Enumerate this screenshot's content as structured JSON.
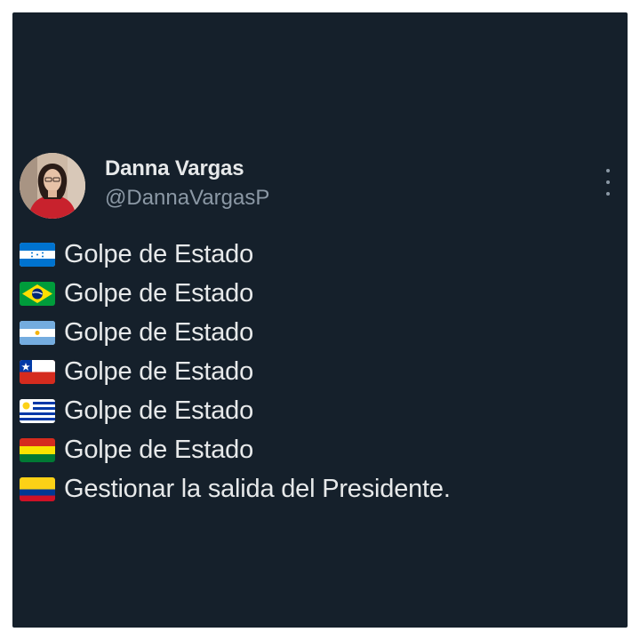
{
  "tweet": {
    "author_name": "Danna Vargas",
    "author_handle": "@DannaVargasP",
    "avatar_icon": "profile-photo",
    "menu_icon": "more-vertical-icon",
    "lines": [
      {
        "flag": "honduras-flag-icon",
        "text": "Golpe de Estado"
      },
      {
        "flag": "brazil-flag-icon",
        "text": "Golpe de Estado"
      },
      {
        "flag": "argentina-flag-icon",
        "text": "Golpe de Estado"
      },
      {
        "flag": "chile-flag-icon",
        "text": "Golpe de Estado"
      },
      {
        "flag": "uruguay-flag-icon",
        "text": "Golpe de Estado"
      },
      {
        "flag": "bolivia-flag-icon",
        "text": "Golpe de Estado"
      },
      {
        "flag": "colombia-flag-icon",
        "text": "Gestionar la salida del Presidente."
      }
    ]
  },
  "colors": {
    "background": "#15202b",
    "primary_text": "#e7e9ea",
    "secondary_text": "#8b98a5"
  }
}
